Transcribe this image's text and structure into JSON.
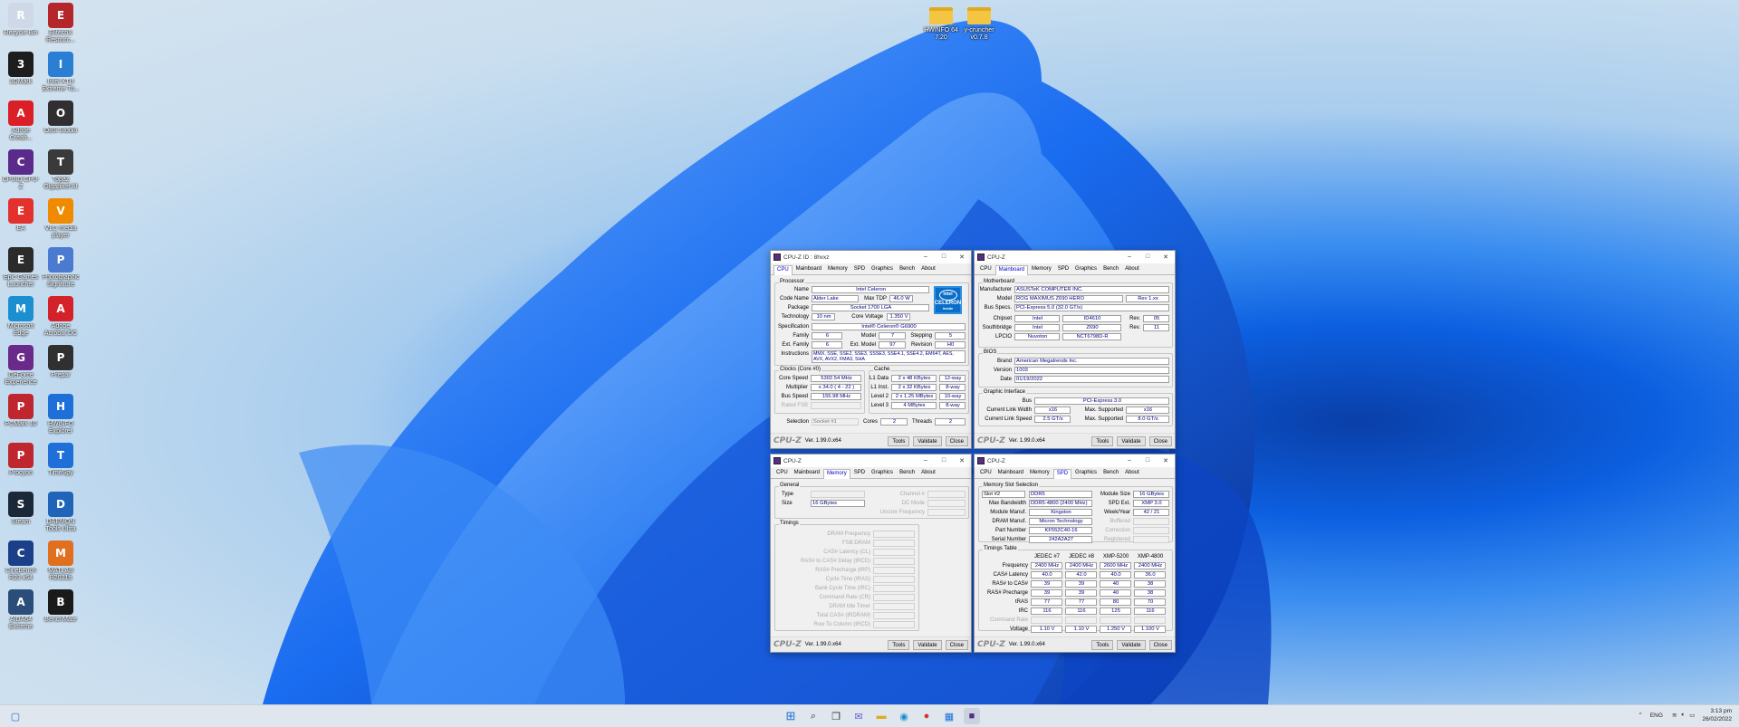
{
  "desktop": {
    "icons": [
      {
        "label": "Recycle Bin",
        "icon": "recycle-bin-icon",
        "color": "#cfd8e6"
      },
      {
        "label": "ElitechX Resourc...",
        "icon": "elitechx-icon",
        "color": "#b5262b"
      },
      {
        "label": "3DMark",
        "icon": "3dmark-icon",
        "color": "#1d1d1d"
      },
      {
        "label": "Intel XTU Extreme Tu...",
        "icon": "intel-xtu-icon",
        "color": "#2a7fd4"
      },
      {
        "label": "Adobe Creati...",
        "icon": "adobe-cc-icon",
        "color": "#da1f26"
      },
      {
        "label": "OBS Studio",
        "icon": "obs-icon",
        "color": "#302e31"
      },
      {
        "label": "CPUID CPU-Z",
        "icon": "cpuz-icon",
        "color": "#5a2b8a"
      },
      {
        "label": "Topaz Gigapixel AI",
        "icon": "topaz-icon",
        "color": "#3a3a3a"
      },
      {
        "label": "EA",
        "icon": "ea-icon",
        "color": "#e5312d"
      },
      {
        "label": "VLC media player",
        "icon": "vlc-icon",
        "color": "#f08a00"
      },
      {
        "label": "Epic Games Launcher",
        "icon": "epic-icon",
        "color": "#2b2b2b"
      },
      {
        "label": "Photographic Signature",
        "icon": "photo-signature-icon",
        "color": "#4a7bd0"
      },
      {
        "label": "Microsoft Edge",
        "icon": "edge-icon",
        "color": "#1c8fd0"
      },
      {
        "label": "Adobe Acrobat DC",
        "icon": "acrobat-icon",
        "color": "#d3222a"
      },
      {
        "label": "GeForce Experience",
        "icon": "geforce-icon",
        "color": "#6a2a8a"
      },
      {
        "label": "Prepar",
        "icon": "prepar-icon",
        "color": "#303030"
      },
      {
        "label": "PCMark 10",
        "icon": "pcmark-icon",
        "color": "#c0262d"
      },
      {
        "label": "HWiNFO Explorer",
        "icon": "hwinfo-icon",
        "color": "#1e6fd8"
      },
      {
        "label": "Procyon",
        "icon": "procyon-icon",
        "color": "#c0262d"
      },
      {
        "label": "TimeSpy",
        "icon": "timespy-icon",
        "color": "#1e6fd8"
      },
      {
        "label": "Steam",
        "icon": "steam-icon",
        "color": "#1b2838"
      },
      {
        "label": "DAEMON Tools Ultra",
        "icon": "daemon-icon",
        "color": "#1f64b8"
      },
      {
        "label": "Cinebench R23 x64",
        "icon": "cinebench-icon",
        "color": "#1c3f8a"
      },
      {
        "label": "MATLAB R2021b",
        "icon": "matlab-icon",
        "color": "#e07020"
      },
      {
        "label": "AIDA64 Extreme",
        "icon": "aida-icon",
        "color": "#2b4d7a"
      },
      {
        "label": "BenchMate",
        "icon": "benchmate-icon",
        "color": "#1a1a1a"
      }
    ],
    "folders": [
      {
        "label": "HWiNFO 64 7.20"
      },
      {
        "label": "y-cruncher v0.7.8"
      }
    ]
  },
  "w_cpu": {
    "title": "CPU-Z   ID : 8hvxz",
    "tabs": [
      "CPU",
      "Mainboard",
      "Memory",
      "SPD",
      "Graphics",
      "Bench",
      "About"
    ],
    "processor": "Processor",
    "name_l": "Name",
    "name": "Intel Celeron",
    "code_l": "Code Name",
    "code": "Alder Lake",
    "tdp_l": "Max TDP",
    "tdp": "46.0 W",
    "pkg_l": "Package",
    "pkg": "Socket 1700 LGA",
    "tech_l": "Technology",
    "tech": "10 nm",
    "cv_l": "Core Voltage",
    "cv": "1.350 V",
    "spec_l": "Specification",
    "spec": "Intel® Celeron® G6900",
    "fam_l": "Family",
    "fam": "6",
    "model_l": "Model",
    "model": "7",
    "step_l": "Stepping",
    "step": "5",
    "efam_l": "Ext. Family",
    "efam": "6",
    "emodel_l": "Ext. Model",
    "emodel": "97",
    "rev_l": "Revision",
    "rev": "H0",
    "instr_l": "Instructions",
    "instr": "MMX, SSE, SSE2, SSE3, SSSE3, SSE4.1, SSE4.2, EM64T, AES, AVX, AVX2, FMA3, SHA",
    "clocks": "Clocks (Core #0)",
    "cs_l": "Core Speed",
    "cs": "5302.54 MHz",
    "mult_l": "Multiplier",
    "mult": "x 34.0 ( 4 - 22 )",
    "bus_l": "Bus Speed",
    "bus": "155.98 MHz",
    "fsb_l": "Rated FSB",
    "cache": "Cache",
    "l1d_l": "L1 Data",
    "l1d": "2 x 48 KBytes",
    "l1d_w": "12-way",
    "l1i_l": "L1 Inst.",
    "l1i": "2 x 32 KBytes",
    "l1i_w": "8-way",
    "l2_l": "Level 2",
    "l2": "2 x 1.25 MBytes",
    "l2_w": "10-way",
    "l3_l": "Level 3",
    "l3": "4 MBytes",
    "l3_w": "8-way",
    "sel_l": "Selection",
    "sel": "Socket #1",
    "cores_l": "Cores",
    "cores": "2",
    "threads_l": "Threads",
    "threads": "2",
    "intel_logo": "intel",
    "intel_sub": "CELERON",
    "intel_inside": "inside"
  },
  "w_mb": {
    "title": "CPU-Z",
    "group_mb": "Motherboard",
    "man_l": "Manufacturer",
    "man": "ASUSTeK COMPUTER INC.",
    "model_l": "Model",
    "model": "ROG MAXIMUS Z690 HERO",
    "model_rev": "Rev 1.xx",
    "bus_l": "Bus Specs.",
    "bus": "PCI-Express 5.0 (32.0 GT/s)",
    "chip_l": "Chipset",
    "chip_a": "Intel",
    "chip_b": "ID4610",
    "chip_rl": "Rev.",
    "chip_r": "05",
    "sb_l": "Southbridge",
    "sb_a": "Intel",
    "sb_b": "Z690",
    "sb_rl": "Rev.",
    "sb_r": "11",
    "lpc_l": "LPCIO",
    "lpc_a": "Nuvoton",
    "lpc_b": "NCT6798D-R",
    "group_bios": "BIOS",
    "brand_l": "Brand",
    "brand": "American Megatrends Inc.",
    "ver_l": "Version",
    "ver": "1003",
    "date_l": "Date",
    "date": "01/19/2022",
    "group_gi": "Graphic Interface",
    "gbus_l": "Bus",
    "gbus": "PCI-Express 3.0",
    "clw_l": "Current Link Width",
    "clw": "x16",
    "msw_l": "Max. Supported",
    "msw": "x16",
    "cls_l": "Current Link Speed",
    "cls": "2.5 GT/s",
    "mss_l": "Max. Supported",
    "mss": "8.0 GT/s"
  },
  "w_mem": {
    "title": "CPU-Z",
    "general": "General",
    "type_l": "Type",
    "size_l": "Size",
    "size": "16 GBytes",
    "ch_l": "Channel #",
    "dc_l": "DC Mode",
    "unc_l": "Uncore Frequency",
    "timings": "Timings",
    "rows": [
      "DRAM Frequency",
      "FSB:DRAM",
      "CAS# Latency (CL)",
      "RAS# to CAS# Delay (tRCD)",
      "RAS# Precharge (tRP)",
      "Cycle Time (tRAS)",
      "Bank Cycle Time (tRC)",
      "Command Rate (CR)",
      "DRAM Idle Timer",
      "Total CAS# (tRDRAM)",
      "Row To Column (tRCD)"
    ]
  },
  "w_spd": {
    "title": "CPU-Z",
    "group": "Memory Slot Selection",
    "slot": "Slot #2",
    "type": "DDR5",
    "msize_l": "Module Size",
    "msize": "16 GBytes",
    "maxbw_l": "Max Bandwidth",
    "maxbw": "DDR5-4800 (2400 MHz)",
    "spdext_l": "SPD Ext.",
    "spdext": "XMP 3.0",
    "mman_l": "Module Manuf.",
    "mman": "Kingston",
    "wy_l": "Week/Year",
    "wy": "42 / 21",
    "dman_l": "DRAM Manuf.",
    "dman": "Micron Technology",
    "buf_l": "Buffered",
    "pn_l": "Part Number",
    "pn": "KF552C40-16",
    "corr_l": "Correction",
    "sn_l": "Serial Number",
    "sn": "242A2A27",
    "reg_l": "Registered",
    "ttable": "Timings Table",
    "cols": [
      "JEDEC #7",
      "JEDEC #8",
      "XMP-5200",
      "XMP-4800"
    ],
    "rows": [
      {
        "l": "Frequency",
        "v": [
          "2400 MHz",
          "2400 MHz",
          "2600 MHz",
          "2400 MHz"
        ]
      },
      {
        "l": "CAS# Latency",
        "v": [
          "40.0",
          "42.0",
          "40.0",
          "36.0"
        ]
      },
      {
        "l": "RAS# to CAS#",
        "v": [
          "39",
          "39",
          "40",
          "38"
        ]
      },
      {
        "l": "RAS# Precharge",
        "v": [
          "39",
          "39",
          "40",
          "38"
        ]
      },
      {
        "l": "tRAS",
        "v": [
          "77",
          "77",
          "80",
          "70"
        ]
      },
      {
        "l": "tRC",
        "v": [
          "116",
          "116",
          "125",
          "116"
        ]
      },
      {
        "l": "Command Rate",
        "v": [
          "",
          "",
          "",
          ""
        ]
      },
      {
        "l": "Voltage",
        "v": [
          "1.10 V",
          "1.10 V",
          "1.250 V",
          "1.100 V"
        ]
      }
    ]
  },
  "footer": {
    "logo": "CPU-Z",
    "ver": "Ver. 1.99.0.x64",
    "tools": "Tools",
    "validate": "Validate",
    "close": "Close"
  },
  "taskbar": {
    "lang": "ENG",
    "time": "3:13 pm",
    "date": "26/02/2022"
  }
}
